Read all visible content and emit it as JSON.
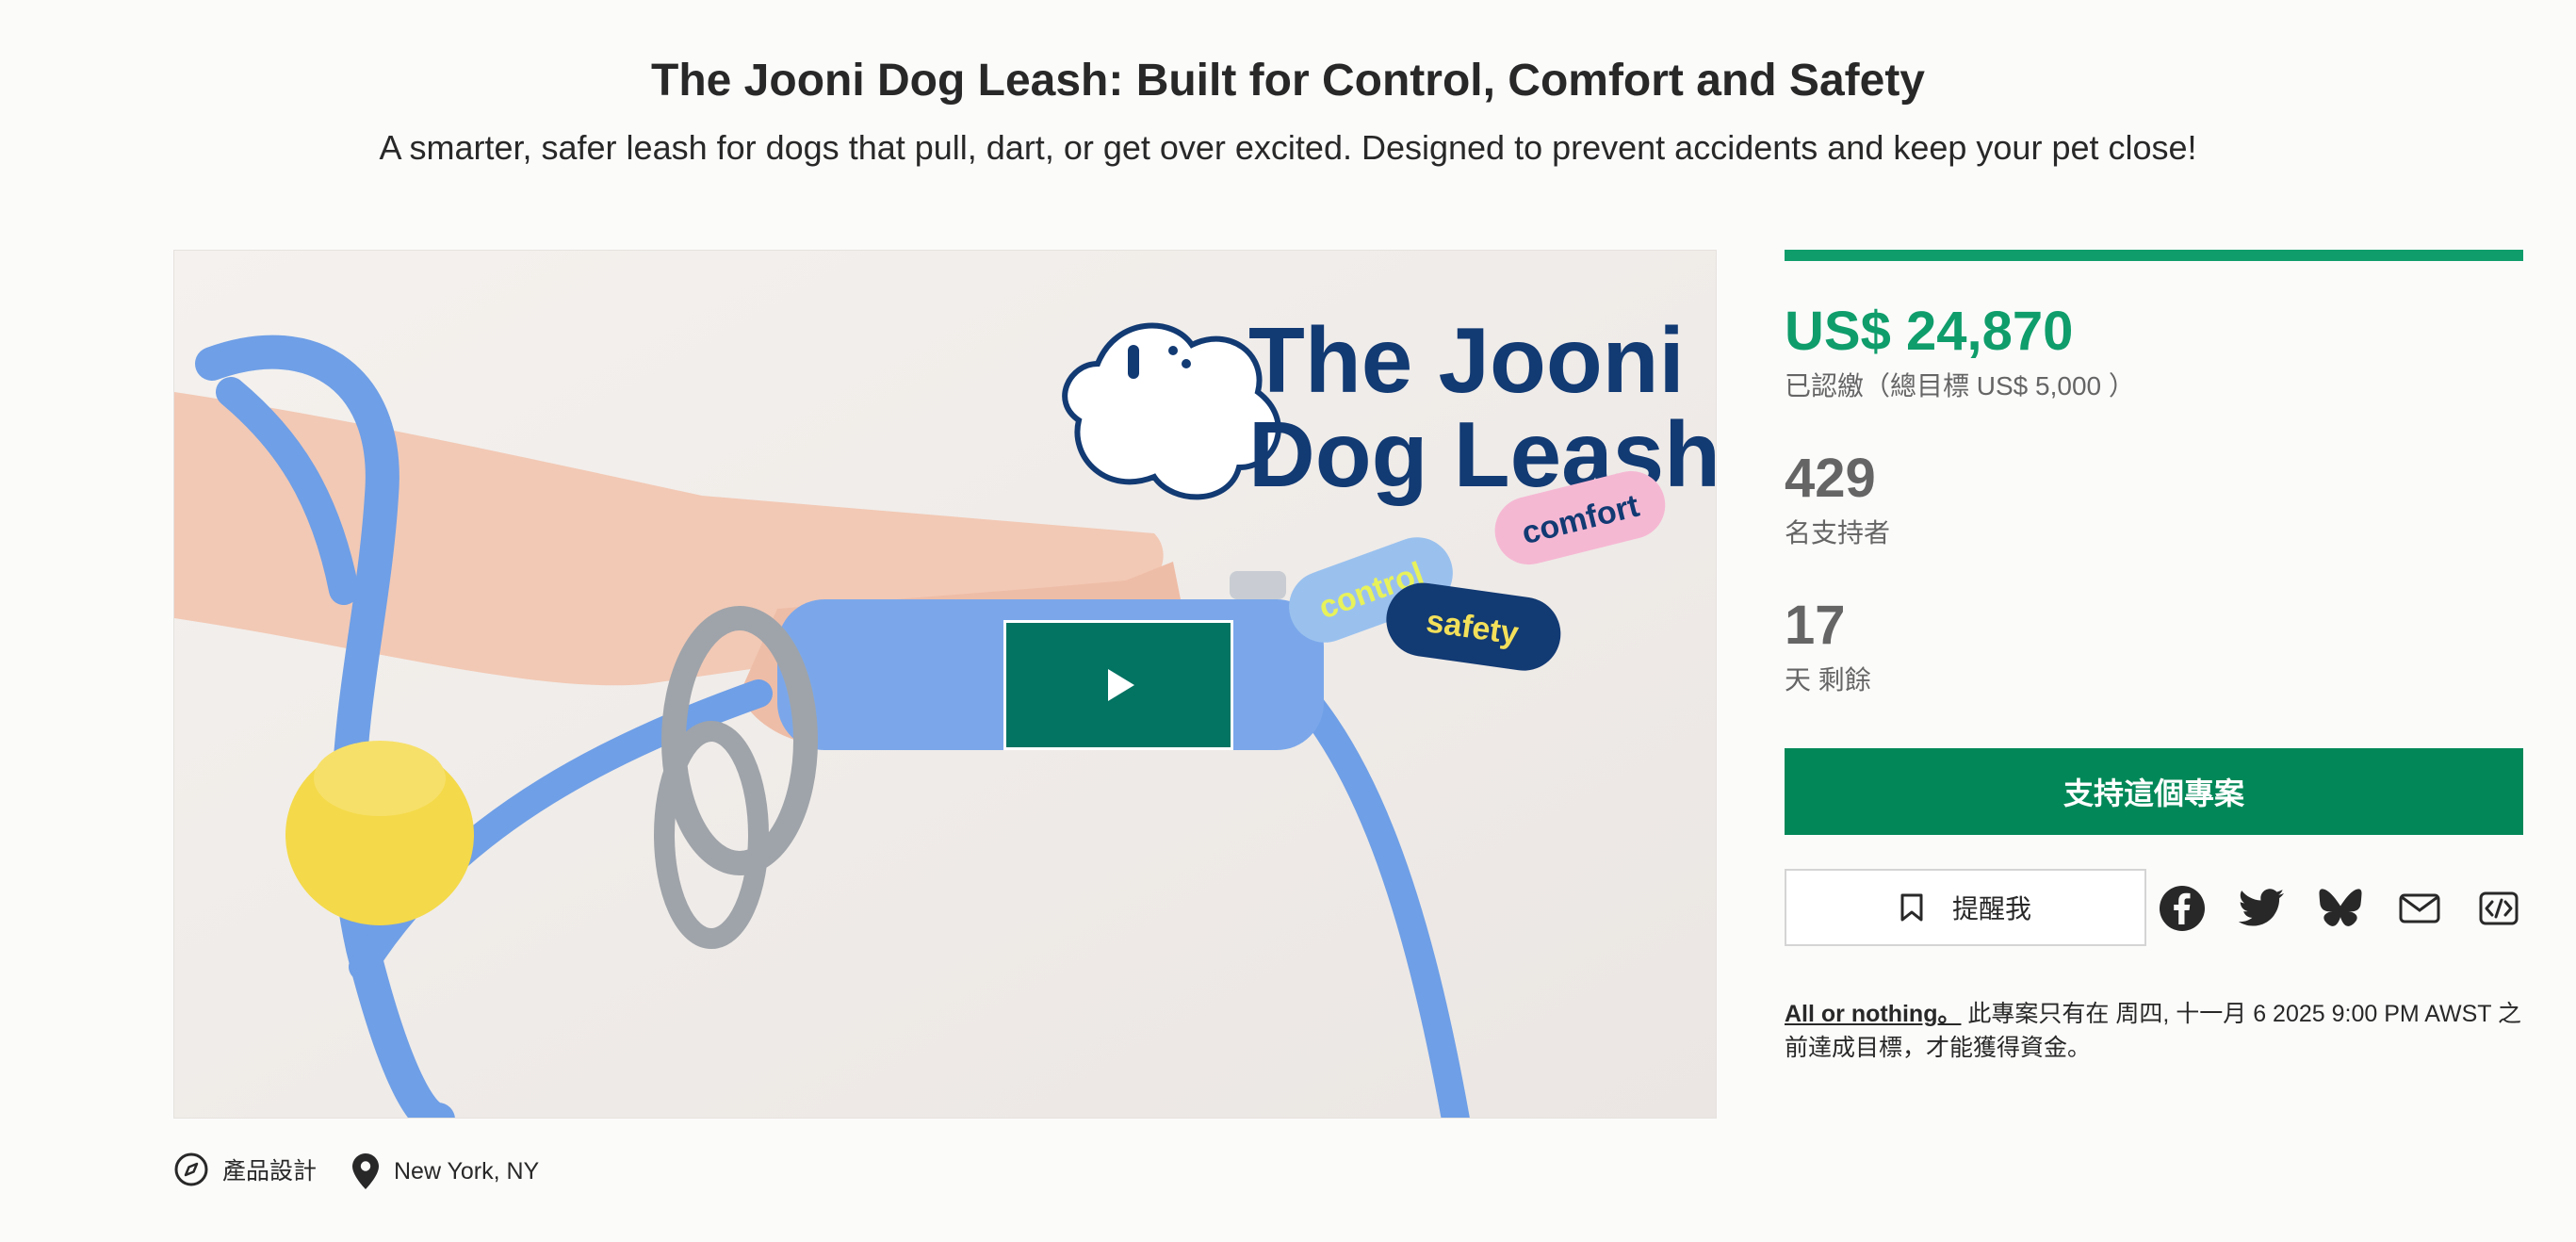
{
  "header": {
    "title": "The Jooni Dog Leash: Built for Control, Comfort and Safety",
    "subtitle": "A smarter, safer leash for dogs that pull, dart, or get over excited. Designed to prevent accidents and keep your pet close!"
  },
  "hero": {
    "logo_line1": "The Jooni",
    "logo_line2": "Dog Leash",
    "pill_comfort": "comfort",
    "pill_control": "control",
    "pill_safety": "safety",
    "play_icon": "play-icon"
  },
  "stats": {
    "progress_fraction": 1.0,
    "pledged": "US$ 24,870",
    "pledged_note": "已認繳（總目標 US$ 5,000 ）",
    "backers": "429",
    "backers_label": "名支持者",
    "days": "17",
    "days_label": "天 剩餘"
  },
  "actions": {
    "back_label": "支持這個專案",
    "remind_label": "提醒我",
    "share_icons": [
      "facebook-icon",
      "twitter-icon",
      "bluesky-icon",
      "email-icon",
      "embed-icon"
    ]
  },
  "funding": {
    "link_text": "All or nothing。",
    "note": " 此專案只有在 周四, 十一月 6 2025 9:00 PM AWST 之前達成目標，才能獲得資金。"
  },
  "meta": {
    "category": "產品設計",
    "location": "New York, NY"
  },
  "colors": {
    "accent": "#0f9d6b",
    "button": "#028858",
    "play": "#037362",
    "leash": "#6f9fe6",
    "logo_navy": "#123a73"
  }
}
